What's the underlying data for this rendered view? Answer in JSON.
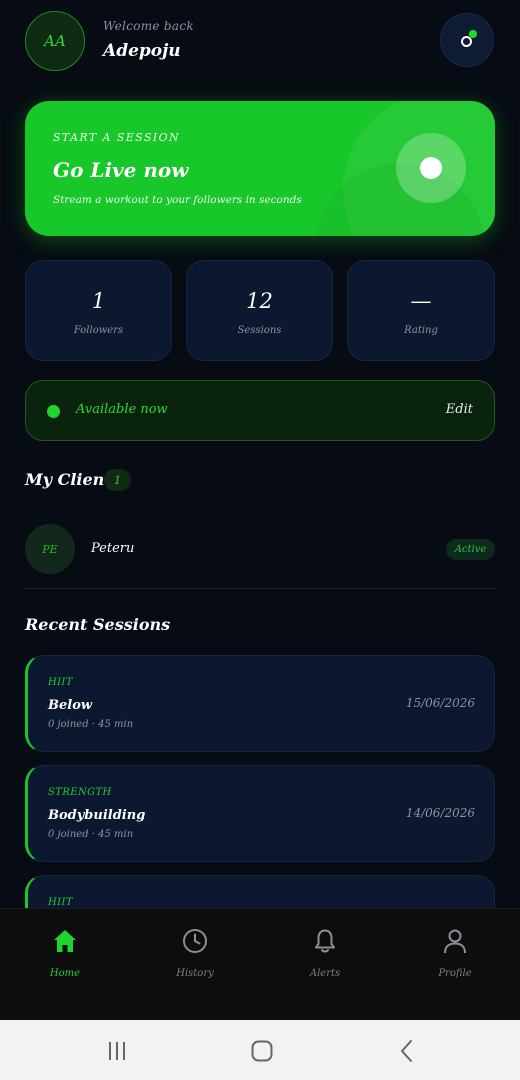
{
  "header": {
    "avatar_initials": "AA",
    "welcome_text": "Welcome back",
    "username": "Adepoju"
  },
  "live_card": {
    "eyebrow": "START A SESSION",
    "title": "Go Live now",
    "subtitle": "Stream a workout to your followers in seconds"
  },
  "stats": [
    {
      "value": "1",
      "label": "Followers"
    },
    {
      "value": "12",
      "label": "Sessions"
    },
    {
      "value": "—",
      "label": "Rating"
    }
  ],
  "availability": {
    "status_text": "Available now",
    "edit_label": "Edit"
  },
  "clients": {
    "title": "My Clients",
    "count": "1",
    "items": [
      {
        "initials": "PE",
        "name": "Peteru",
        "status": "Active"
      }
    ]
  },
  "sessions": {
    "title": "Recent Sessions",
    "items": [
      {
        "type": "HIIT",
        "name": "Below",
        "meta": "0 joined · 45 min",
        "date": "15/06/2026"
      },
      {
        "type": "STRENGTH",
        "name": "Bodybuilding",
        "meta": "0 joined · 45 min",
        "date": "14/06/2026"
      },
      {
        "type": "HIIT",
        "name": "",
        "meta": "",
        "date": ""
      }
    ]
  },
  "nav": {
    "items": [
      {
        "label": "Home",
        "icon": "home-icon",
        "active": true
      },
      {
        "label": "History",
        "icon": "clock-icon",
        "active": false
      },
      {
        "label": "Alerts",
        "icon": "bell-icon",
        "active": false
      },
      {
        "label": "Profile",
        "icon": "person-icon",
        "active": false
      }
    ]
  },
  "colors": {
    "accent": "#1fc42b",
    "background": "#070b13",
    "card": "#0c1830"
  }
}
